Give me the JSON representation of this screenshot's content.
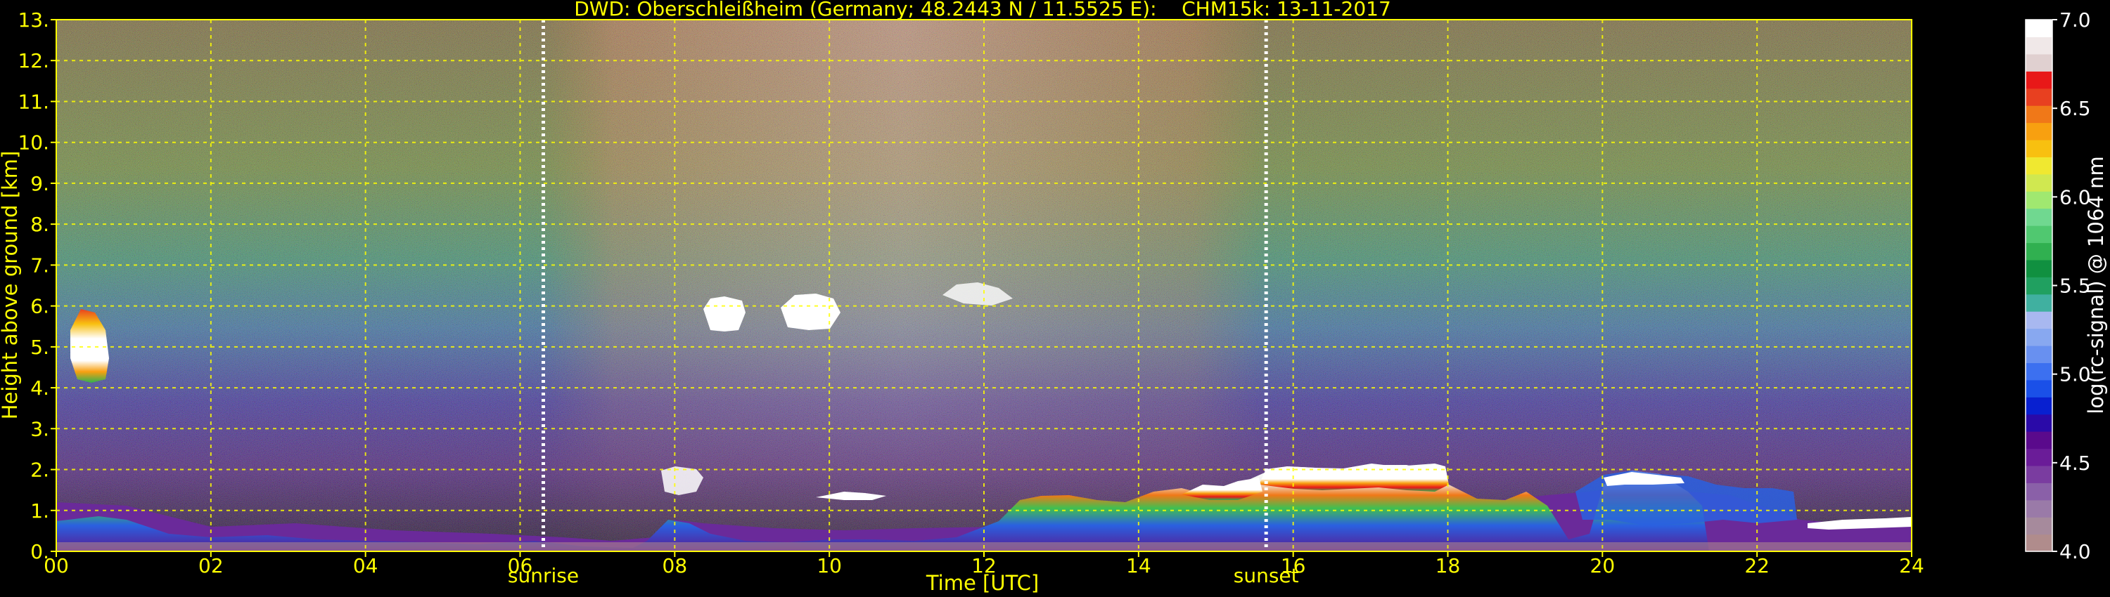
{
  "chart_data": {
    "type": "heatmap",
    "title": "DWD: Oberschleißheim (Germany; 48.2443 N / 11.5525 E):    CHM15k: 13-11-2017",
    "xlabel": "Time [UTC]",
    "ylabel": "Height above ground [km]",
    "colorbar_label": "log(rc-signal) @ 1064 nm",
    "xlim": [
      0,
      24
    ],
    "ylim": [
      0,
      13
    ],
    "x_ticks": [
      "00",
      "02",
      "04",
      "06",
      "08",
      "10",
      "12",
      "14",
      "16",
      "18",
      "20",
      "22",
      "24"
    ],
    "y_ticks": [
      "0.",
      "1.",
      "2.",
      "3.",
      "4.",
      "5.",
      "6.",
      "7.",
      "8.",
      "9.",
      "10.",
      "11.",
      "12.",
      "13."
    ],
    "grid": true,
    "colorbar": {
      "range": [
        4.0,
        7.0
      ],
      "ticks": [
        "4.0",
        "4.5",
        "5.0",
        "5.5",
        "6.0",
        "6.5",
        "7.0"
      ],
      "colors": [
        "#b08c8c",
        "#a68a9c",
        "#9a7aa8",
        "#8a60a8",
        "#7a3ca0",
        "#6a1c98",
        "#5a0a8c",
        "#2a0aa8",
        "#0820d0",
        "#1a50e8",
        "#3c70f0",
        "#6890f0",
        "#88a8f0",
        "#a8b8f0",
        "#40b0a0",
        "#20a060",
        "#109040",
        "#30b050",
        "#50c870",
        "#70d890",
        "#a0e870",
        "#d0e850",
        "#f0e830",
        "#f8c010",
        "#f8a010",
        "#f07818",
        "#e84020",
        "#e81818",
        "#e0d0d0",
        "#f0e8e8",
        "#ffffff"
      ]
    },
    "events": [
      {
        "label": "sunrise",
        "time": 6.3
      },
      {
        "label": "sunset",
        "time": 15.65
      }
    ]
  }
}
